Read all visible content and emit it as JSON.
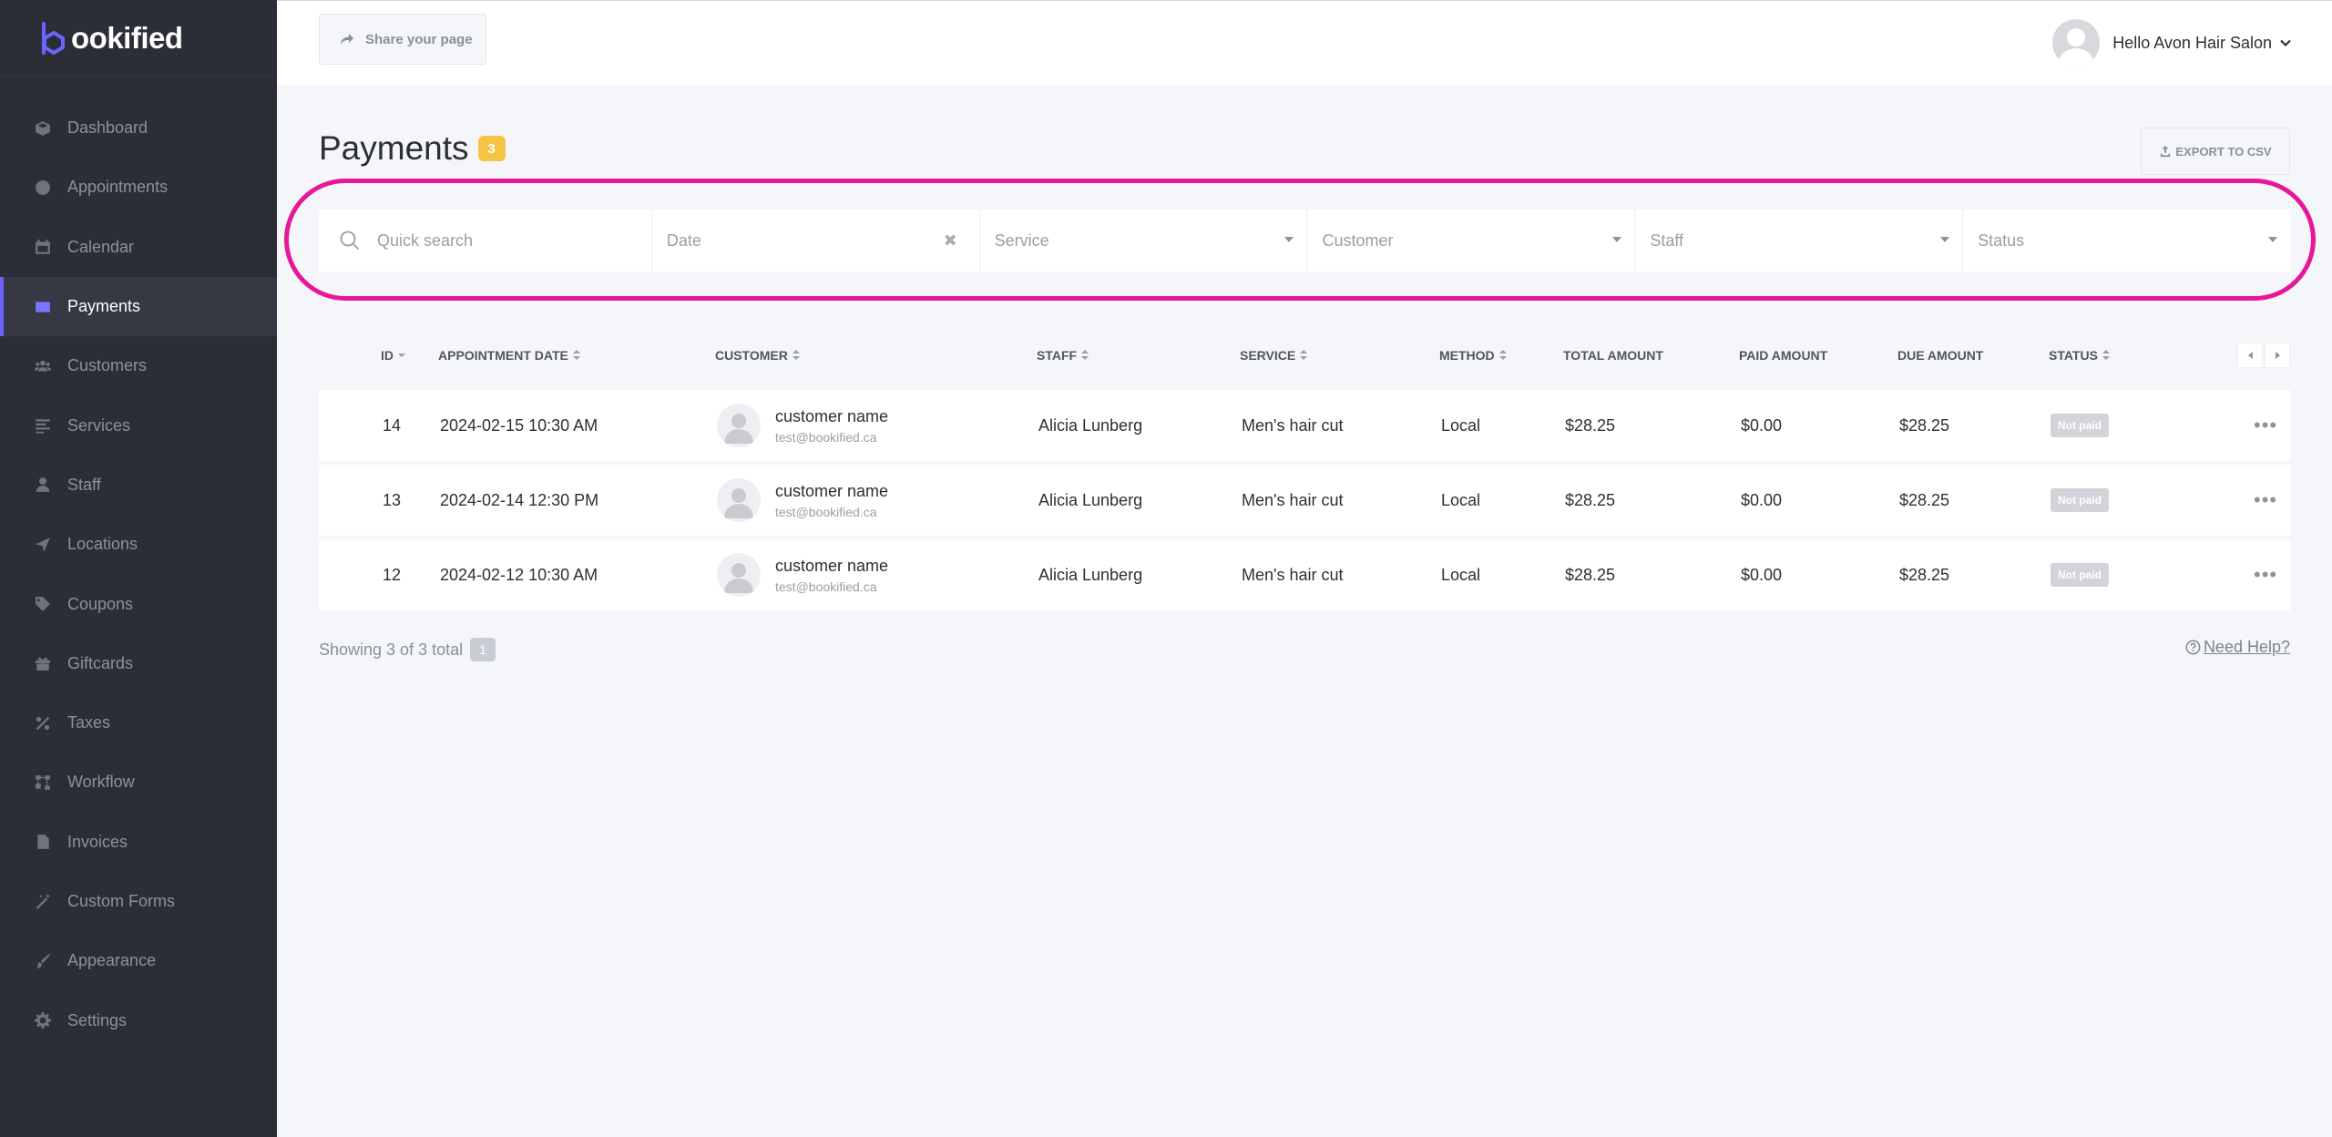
{
  "brand": {
    "name": "ookified",
    "accent": "#6c63ff"
  },
  "sidebar": {
    "items": [
      {
        "label": "Dashboard",
        "icon": "cube-icon"
      },
      {
        "label": "Appointments",
        "icon": "clock-icon"
      },
      {
        "label": "Calendar",
        "icon": "calendar-icon"
      },
      {
        "label": "Payments",
        "icon": "wallet-icon",
        "active": true
      },
      {
        "label": "Customers",
        "icon": "users-icon"
      },
      {
        "label": "Services",
        "icon": "list-icon"
      },
      {
        "label": "Staff",
        "icon": "user-icon"
      },
      {
        "label": "Locations",
        "icon": "location-arrow-icon"
      },
      {
        "label": "Coupons",
        "icon": "tag-icon"
      },
      {
        "label": "Giftcards",
        "icon": "gift-icon"
      },
      {
        "label": "Taxes",
        "icon": "percent-icon"
      },
      {
        "label": "Workflow",
        "icon": "workflow-icon"
      },
      {
        "label": "Invoices",
        "icon": "file-icon"
      },
      {
        "label": "Custom Forms",
        "icon": "magic-wand-icon"
      },
      {
        "label": "Appearance",
        "icon": "brush-icon"
      },
      {
        "label": "Settings",
        "icon": "gear-icon"
      }
    ]
  },
  "header": {
    "share_label": "Share your page",
    "user_greeting": "Hello Avon Hair Salon"
  },
  "page": {
    "title": "Payments",
    "count": "3",
    "export_label": "EXPORT TO CSV"
  },
  "filters": {
    "search_placeholder": "Quick search",
    "date_placeholder": "Date",
    "service_placeholder": "Service",
    "customer_placeholder": "Customer",
    "staff_placeholder": "Staff",
    "status_placeholder": "Status",
    "highlight_color": "#e6179a"
  },
  "table": {
    "headers": {
      "id": "ID",
      "date": "APPOINTMENT DATE",
      "customer": "CUSTOMER",
      "staff": "STAFF",
      "service": "SERVICE",
      "method": "METHOD",
      "total": "TOTAL AMOUNT",
      "paid": "PAID AMOUNT",
      "due": "DUE AMOUNT",
      "status": "STATUS"
    },
    "rows": [
      {
        "id": "14",
        "date": "2024-02-15 10:30 AM",
        "customer_name": "customer name",
        "customer_email": "test@bookified.ca",
        "staff": "Alicia Lunberg",
        "service": "Men's hair cut",
        "method": "Local",
        "total": "$28.25",
        "paid": "$0.00",
        "due": "$28.25",
        "status": "Not paid"
      },
      {
        "id": "13",
        "date": "2024-02-14 12:30 PM",
        "customer_name": "customer name",
        "customer_email": "test@bookified.ca",
        "staff": "Alicia Lunberg",
        "service": "Men's hair cut",
        "method": "Local",
        "total": "$28.25",
        "paid": "$0.00",
        "due": "$28.25",
        "status": "Not paid"
      },
      {
        "id": "12",
        "date": "2024-02-12 10:30 AM",
        "customer_name": "customer name",
        "customer_email": "test@bookified.ca",
        "staff": "Alicia Lunberg",
        "service": "Men's hair cut",
        "method": "Local",
        "total": "$28.25",
        "paid": "$0.00",
        "due": "$28.25",
        "status": "Not paid"
      }
    ]
  },
  "footer": {
    "showing_text": "Showing 3 of 3 total",
    "page": "1",
    "help_label": "Need Help?"
  }
}
